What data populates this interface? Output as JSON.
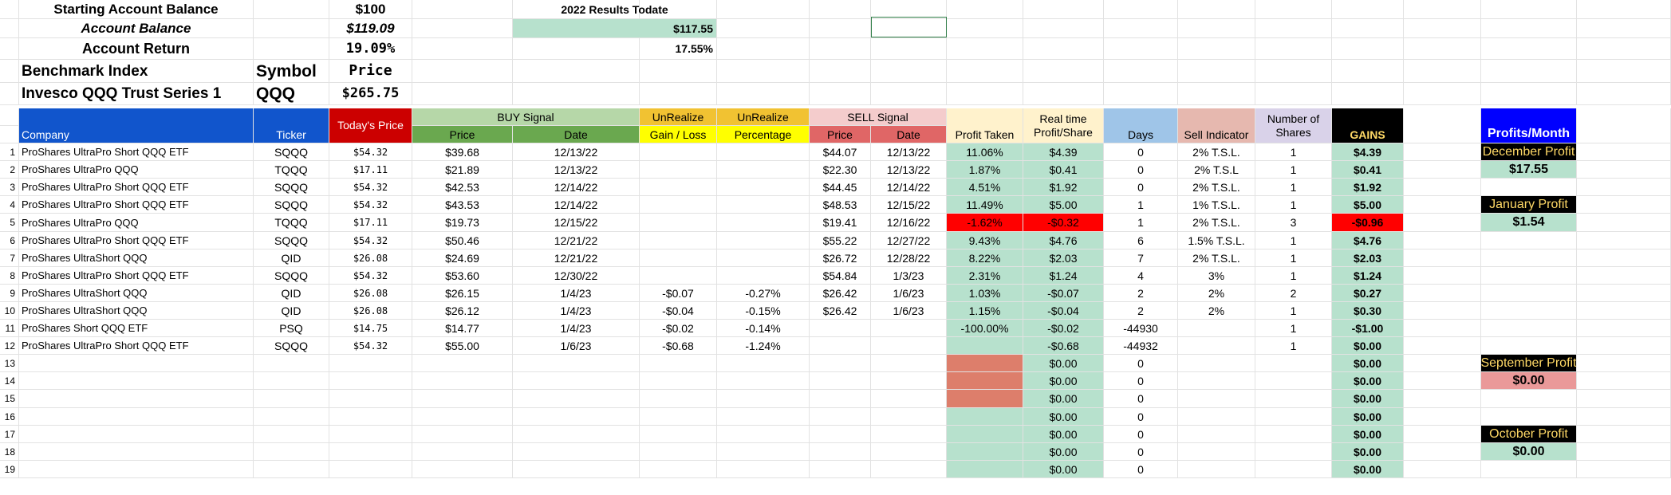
{
  "summary": {
    "starting_label": "Starting Account Balance",
    "starting_value": "$100",
    "results_label": "2022 Results Todate",
    "balance_label": "Account Balance",
    "balance_value": "$119.09",
    "results_value": "$117.55",
    "return_label": "Account Return",
    "return_value": "19.09%",
    "results_pct": "17.55%",
    "benchmark_label": "Benchmark Index",
    "symbol_label": "Symbol",
    "price_label": "Price",
    "benchmark_name": "Invesco QQQ Trust Series 1",
    "benchmark_symbol": "QQQ",
    "benchmark_price": "$265.75"
  },
  "headers": {
    "buy_signal": "BUY Signal",
    "unrealize1": "UnRealize",
    "unrealize2": "UnRealize",
    "sell_signal": "SELL Signal",
    "company": "Company",
    "ticker": "Ticker",
    "todays_price": "Today's Price",
    "buy_price": "Price",
    "buy_date": "Date",
    "gain_loss": "Gain / Loss",
    "percentage": "Percentage",
    "sell_price": "Price",
    "sell_date": "Date",
    "profit_taken": "Profit Taken",
    "realtime": "Real time Profit/Share",
    "days": "Days",
    "sell_indicator": "Sell Indicator",
    "num_shares": "Number of Shares",
    "gains": "GAINS",
    "profits_month": "Profits/Month"
  },
  "rows": [
    {
      "n": "1",
      "company": "ProShares UltraPro Short QQQ ETF",
      "ticker": "SQQQ",
      "today": "$54.32",
      "bp": "$39.68",
      "bd": "12/13/22",
      "ugl": "",
      "upct": "",
      "sp": "$44.07",
      "sd": "12/13/22",
      "pt": "11.06%",
      "rt": "$4.39",
      "days": "0",
      "si": "2% T.S.L.",
      "sh": "1",
      "gain": "$4.39"
    },
    {
      "n": "2",
      "company": "ProShares UltraPro QQQ",
      "ticker": "TQQQ",
      "today": "$17.11",
      "bp": "$21.89",
      "bd": "12/13/22",
      "ugl": "",
      "upct": "",
      "sp": "$22.30",
      "sd": "12/13/22",
      "pt": "1.87%",
      "rt": "$0.41",
      "days": "0",
      "si": "2% T.S.L",
      "sh": "1",
      "gain": "$0.41"
    },
    {
      "n": "3",
      "company": "ProShares UltraPro Short QQQ ETF",
      "ticker": "SQQQ",
      "today": "$54.32",
      "bp": "$42.53",
      "bd": "12/14/22",
      "ugl": "",
      "upct": "",
      "sp": "$44.45",
      "sd": "12/14/22",
      "pt": "4.51%",
      "rt": "$1.92",
      "days": "0",
      "si": "2% T.S.L.",
      "sh": "1",
      "gain": "$1.92"
    },
    {
      "n": "4",
      "company": "ProShares UltraPro Short QQQ ETF",
      "ticker": "SQQQ",
      "today": "$54.32",
      "bp": "$43.53",
      "bd": "12/14/22",
      "ugl": "",
      "upct": "",
      "sp": "$48.53",
      "sd": "12/15/22",
      "pt": "11.49%",
      "rt": "$5.00",
      "days": "1",
      "si": "1% T.S.L.",
      "sh": "1",
      "gain": "$5.00"
    },
    {
      "n": "5",
      "company": "ProShares UltraPro QQQ",
      "ticker": "TQQQ",
      "today": "$17.11",
      "bp": "$19.73",
      "bd": "12/15/22",
      "ugl": "",
      "upct": "",
      "sp": "$19.41",
      "sd": "12/16/22",
      "pt": "-1.62%",
      "rt": "-$0.32",
      "days": "1",
      "si": "2% T.S.L.",
      "sh": "3",
      "gain": "-$0.96",
      "neg": true
    },
    {
      "n": "6",
      "company": "ProShares UltraPro Short QQQ ETF",
      "ticker": "SQQQ",
      "today": "$54.32",
      "bp": "$50.46",
      "bd": "12/21/22",
      "ugl": "",
      "upct": "",
      "sp": "$55.22",
      "sd": "12/27/22",
      "pt": "9.43%",
      "rt": "$4.76",
      "days": "6",
      "si": "1.5% T.S.L.",
      "sh": "1",
      "gain": "$4.76"
    },
    {
      "n": "7",
      "company": "ProShares UltraShort QQQ",
      "ticker": "QID",
      "today": "$26.08",
      "bp": "$24.69",
      "bd": "12/21/22",
      "ugl": "",
      "upct": "",
      "sp": "$26.72",
      "sd": "12/28/22",
      "pt": "8.22%",
      "rt": "$2.03",
      "days": "7",
      "si": "2% T.S.L.",
      "sh": "1",
      "gain": "$2.03"
    },
    {
      "n": "8",
      "company": "ProShares UltraPro Short QQQ ETF",
      "ticker": "SQQQ",
      "today": "$54.32",
      "bp": "$53.60",
      "bd": "12/30/22",
      "ugl": "",
      "upct": "",
      "sp": "$54.84",
      "sd": "1/3/23",
      "pt": "2.31%",
      "rt": "$1.24",
      "days": "4",
      "si": "3%",
      "sh": "1",
      "gain": "$1.24"
    },
    {
      "n": "9",
      "company": "ProShares UltraShort QQQ",
      "ticker": "QID",
      "today": "$26.08",
      "bp": "$26.15",
      "bd": "1/4/23",
      "ugl": "-$0.07",
      "upct": "-0.27%",
      "sp": "$26.42",
      "sd": "1/6/23",
      "pt": "1.03%",
      "rt": "-$0.07",
      "days": "2",
      "si": "2%",
      "sh": "2",
      "gain": "$0.27"
    },
    {
      "n": "10",
      "company": "ProShares UltraShort QQQ",
      "ticker": "QID",
      "today": "$26.08",
      "bp": "$26.12",
      "bd": "1/4/23",
      "ugl": "-$0.04",
      "upct": "-0.15%",
      "sp": "$26.42",
      "sd": "1/6/23",
      "pt": "1.15%",
      "rt": "-$0.04",
      "days": "2",
      "si": "2%",
      "sh": "1",
      "gain": "$0.30"
    },
    {
      "n": "11",
      "company": "ProShares Short QQQ ETF",
      "ticker": "PSQ",
      "today": "$14.75",
      "bp": "$14.77",
      "bd": "1/4/23",
      "ugl": "-$0.02",
      "upct": "-0.14%",
      "sp": "",
      "sd": "",
      "pt": "-100.00%",
      "rt": "-$0.02",
      "days": "-44930",
      "si": "",
      "sh": "1",
      "gain": "-$1.00"
    },
    {
      "n": "12",
      "company": "ProShares UltraPro Short QQQ ETF",
      "ticker": "SQQQ",
      "today": "$54.32",
      "bp": "$55.00",
      "bd": "1/6/23",
      "ugl": "-$0.68",
      "upct": "-1.24%",
      "sp": "",
      "sd": "",
      "pt": "",
      "rt": "-$0.68",
      "days": "-44932",
      "si": "",
      "sh": "1",
      "gain": "$0.00"
    },
    {
      "n": "13",
      "rt": "$0.00",
      "days": "0",
      "gain": "$0.00",
      "ptfill": "salmon"
    },
    {
      "n": "14",
      "rt": "$0.00",
      "days": "0",
      "gain": "$0.00",
      "ptfill": "salmon"
    },
    {
      "n": "15",
      "rt": "$0.00",
      "days": "0",
      "gain": "$0.00",
      "ptfill": "salmon"
    },
    {
      "n": "16",
      "rt": "$0.00",
      "days": "0",
      "gain": "$0.00"
    },
    {
      "n": "17",
      "rt": "$0.00",
      "days": "0",
      "gain": "$0.00"
    },
    {
      "n": "18",
      "rt": "$0.00",
      "days": "0",
      "gain": "$0.00"
    },
    {
      "n": "19",
      "rt": "$0.00",
      "days": "0",
      "gain": "$0.00"
    }
  ],
  "monthly": [
    {
      "label": "December Profit",
      "value": "$17.55",
      "value_bg": "#b7e1cd"
    },
    {
      "label": "January Profit",
      "value": "$1.54",
      "value_bg": "#b7e1cd"
    },
    {
      "label": "September Profit",
      "value": "$0.00",
      "value_bg": "#ea9999"
    },
    {
      "label": "October Profit",
      "value": "$0.00",
      "value_bg": "#b7e1cd"
    }
  ],
  "colors": {
    "blue_header": "#1155cc",
    "red_header": "#cc0000",
    "buy_light": "#b6d7a8",
    "buy_dark": "#6aa84f",
    "unrealize": "#f1c232",
    "unrealize_yellow": "#ffff00",
    "sell_light": "#f4cccc",
    "sell_dark": "#e06666",
    "profit_taken": "#fff2cc",
    "green_cell": "#b7e1cd",
    "red_cell": "#ff0000",
    "days_blue": "#9fc5e8",
    "sell_ind": "#e6b8af",
    "shares": "#d9d2e9",
    "black": "#000000",
    "gold": "#ffd966",
    "blue_month": "#0000ff"
  }
}
